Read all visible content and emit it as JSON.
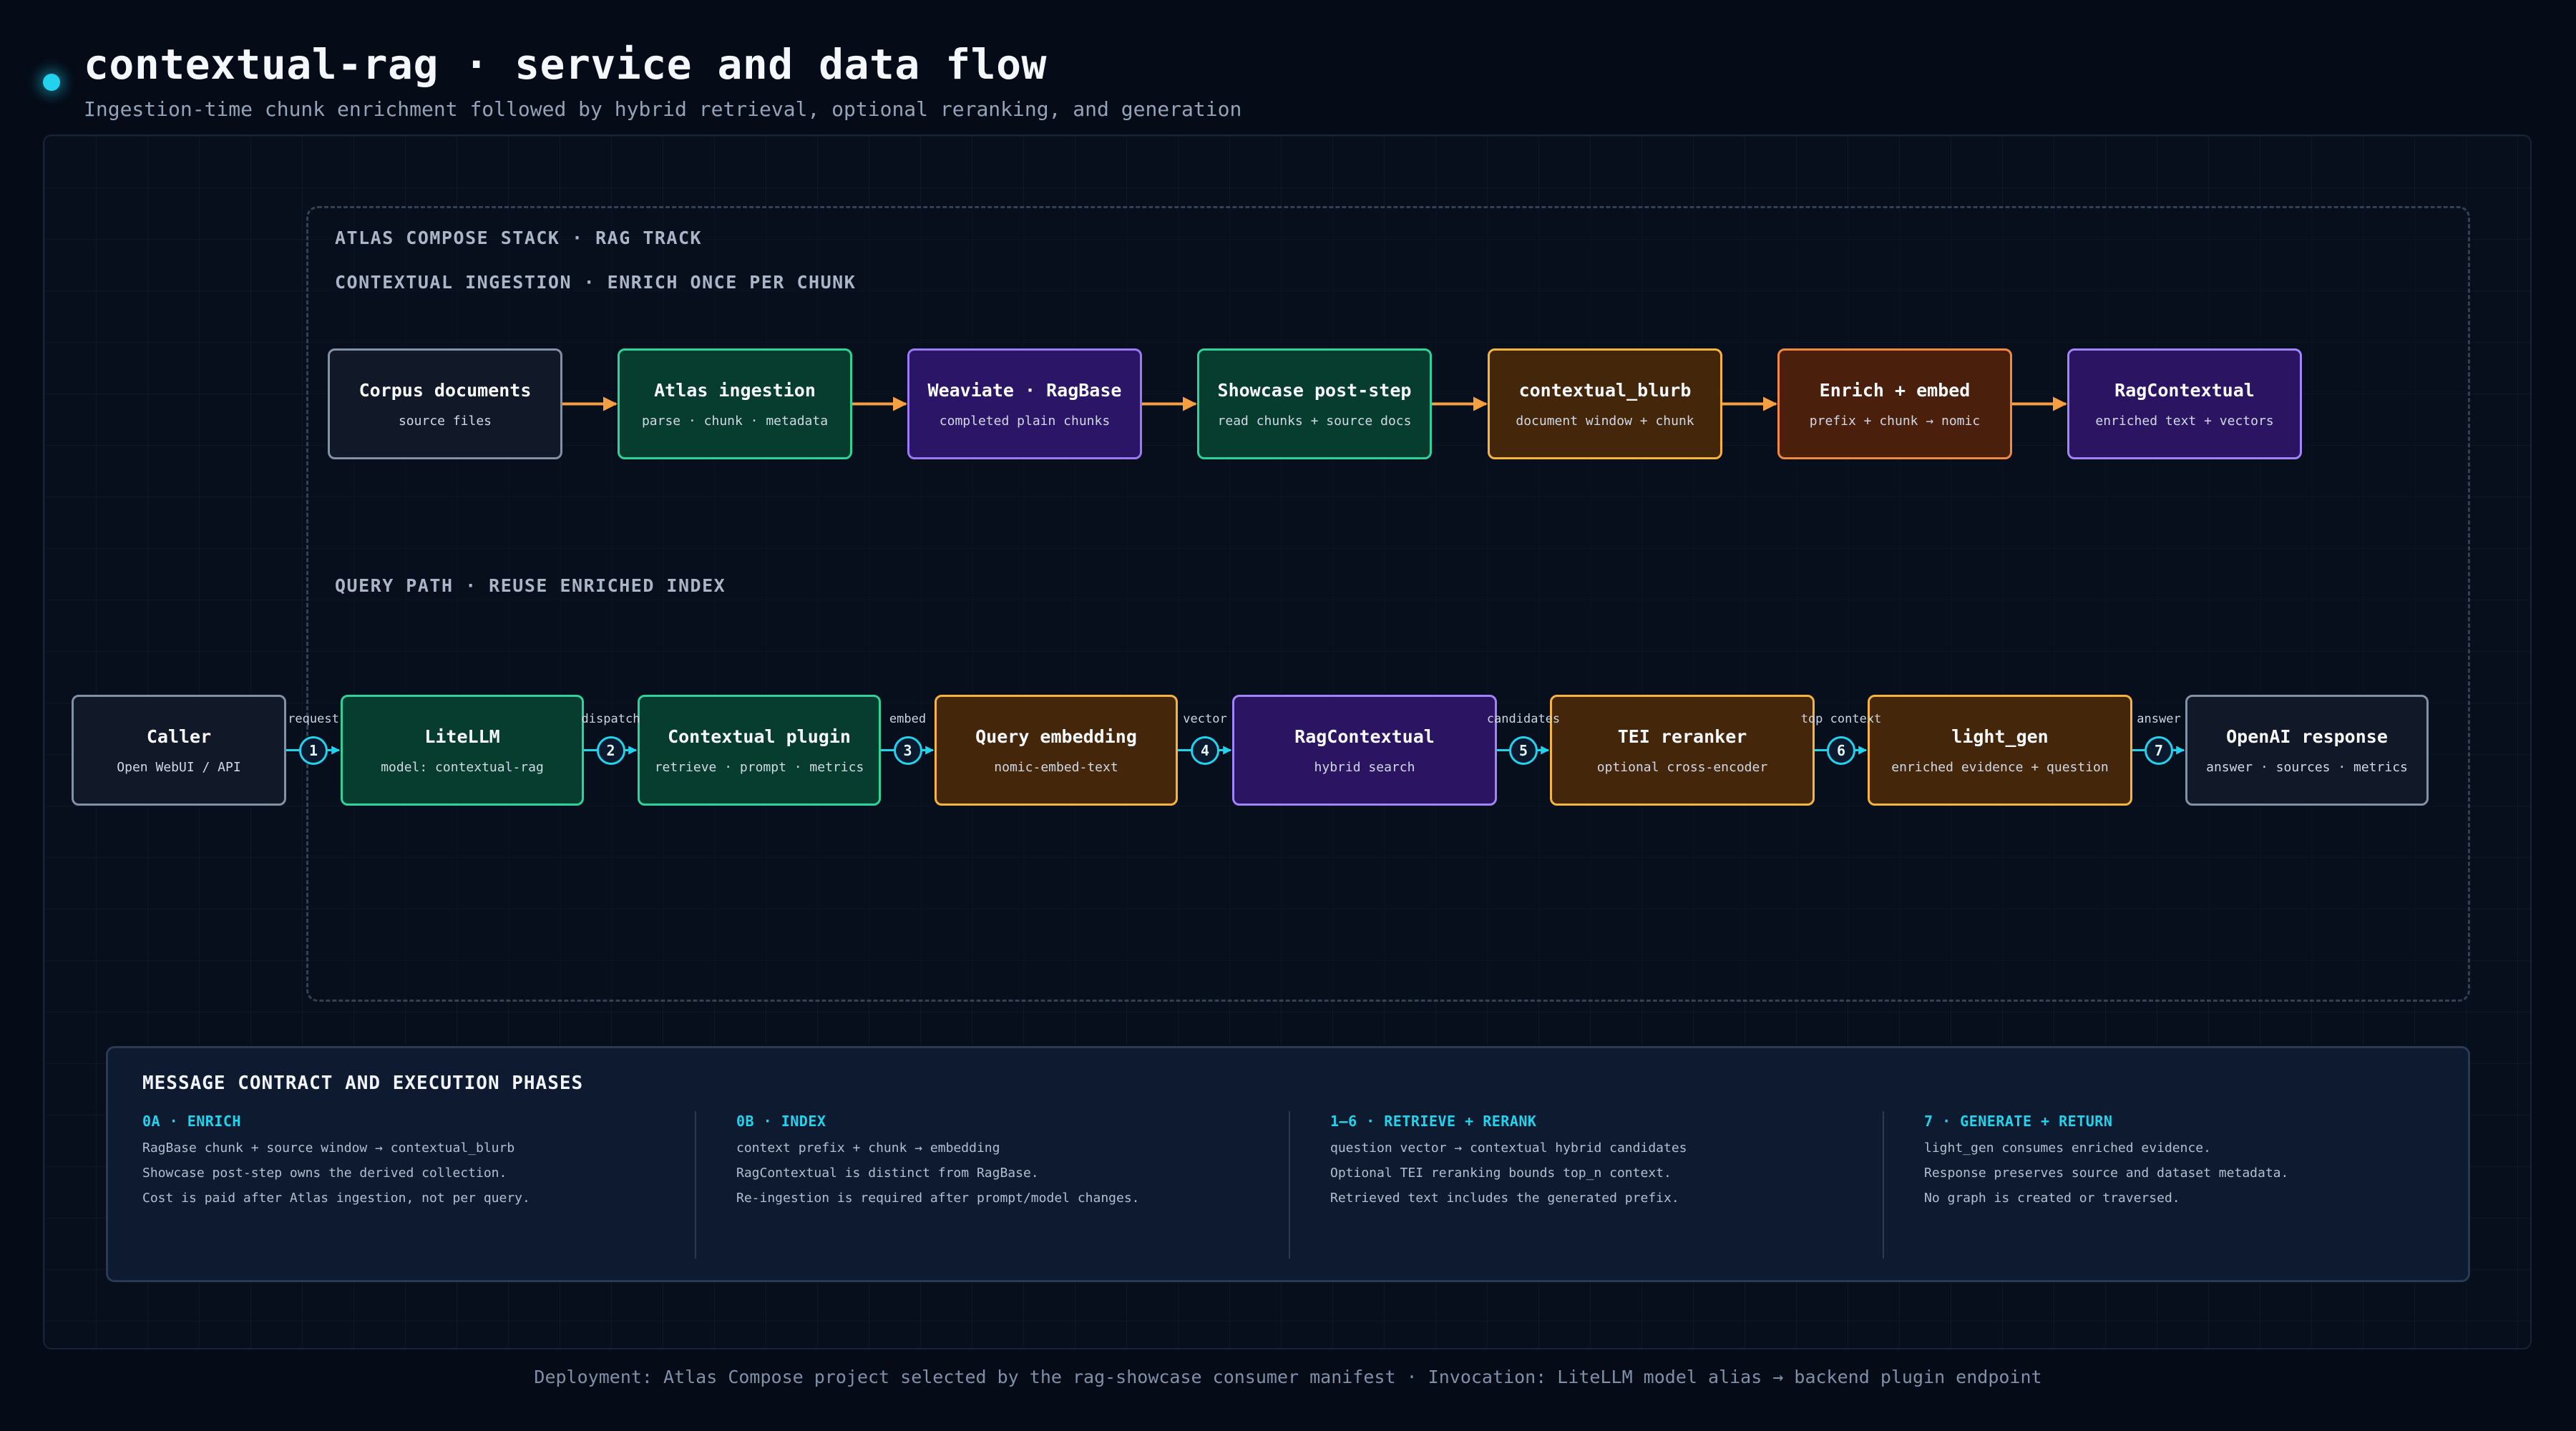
{
  "header": {
    "title": "contextual-rag · service and data flow",
    "subtitle": "Ingestion-time chunk enrichment followed by hybrid retrieval, optional reranking, and generation"
  },
  "stack": {
    "label": "ATLAS COMPOSE STACK · RAG TRACK",
    "ingestion_label": "CONTEXTUAL INGESTION · ENRICH ONCE PER CHUNK",
    "query_label": "QUERY PATH · REUSE ENRICHED INDEX"
  },
  "ingestion_nodes": [
    {
      "title": "Corpus documents",
      "sub": "source files"
    },
    {
      "title": "Atlas ingestion",
      "sub": "parse · chunk · metadata"
    },
    {
      "title": "Weaviate · RagBase",
      "sub": "completed plain chunks"
    },
    {
      "title": "Showcase post-step",
      "sub": "read chunks + source docs"
    },
    {
      "title": "contextual_blurb",
      "sub": "document window + chunk"
    },
    {
      "title": "Enrich + embed",
      "sub": "prefix + chunk → nomic"
    },
    {
      "title": "RagContextual",
      "sub": "enriched text + vectors"
    }
  ],
  "query_nodes": [
    {
      "title": "Caller",
      "sub": "Open WebUI / API"
    },
    {
      "title": "LiteLLM",
      "sub": "model: contextual-rag"
    },
    {
      "title": "Contextual plugin",
      "sub": "retrieve · prompt · metrics"
    },
    {
      "title": "Query embedding",
      "sub": "nomic-embed-text"
    },
    {
      "title": "RagContextual",
      "sub": "hybrid search"
    },
    {
      "title": "TEI reranker",
      "sub": "optional cross-encoder"
    },
    {
      "title": "light_gen",
      "sub": "enriched evidence + question"
    },
    {
      "title": "OpenAI response",
      "sub": "answer · sources · metrics"
    }
  ],
  "query_edges": [
    {
      "step": "1",
      "label": "request"
    },
    {
      "step": "2",
      "label": "dispatch"
    },
    {
      "step": "3",
      "label": "embed"
    },
    {
      "step": "4",
      "label": "vector"
    },
    {
      "step": "5",
      "label": "candidates"
    },
    {
      "step": "6",
      "label": "top context"
    },
    {
      "step": "7",
      "label": "answer"
    }
  ],
  "contract": {
    "title": "MESSAGE CONTRACT AND EXECUTION PHASES",
    "phases": [
      {
        "title": "0A · ENRICH",
        "lines": [
          "RagBase chunk + source window → contextual_blurb",
          "Showcase post-step owns the derived collection.",
          "Cost is paid after Atlas ingestion, not per query."
        ]
      },
      {
        "title": "0B · INDEX",
        "lines": [
          "context prefix + chunk → embedding",
          "RagContextual is distinct from RagBase.",
          "Re-ingestion is required after prompt/model changes."
        ]
      },
      {
        "title": "1–6 · RETRIEVE + RERANK",
        "lines": [
          "question vector → contextual hybrid candidates",
          "Optional TEI reranking bounds top_n context.",
          "Retrieved text includes the generated prefix."
        ]
      },
      {
        "title": "7 · GENERATE + RETURN",
        "lines": [
          "light_gen consumes enriched evidence.",
          "Response preserves source and dataset metadata.",
          "No graph is created or traversed."
        ]
      }
    ]
  },
  "footer": "Deployment: Atlas Compose project selected by the rag-showcase consumer manifest · Invocation: LiteLLM model alias → backend plugin endpoint",
  "colors": {
    "ingest_arrow": "#f59e42",
    "query_arrow": "#22d3ee",
    "accent": "#22d3ee"
  }
}
